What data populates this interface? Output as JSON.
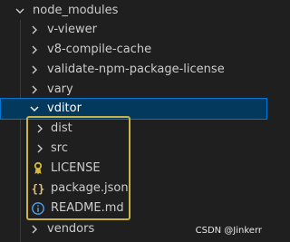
{
  "explorer": {
    "root": {
      "label": "node_modules",
      "icon": "chevron-down-icon"
    },
    "items": [
      {
        "label": "v-viewer",
        "icon": "chevron-right-icon"
      },
      {
        "label": "v8-compile-cache",
        "icon": "chevron-right-icon"
      },
      {
        "label": "validate-npm-package-license",
        "icon": "chevron-right-icon"
      },
      {
        "label": "vary",
        "icon": "chevron-right-icon"
      }
    ],
    "selected": {
      "label": "vditor",
      "icon": "chevron-down-icon"
    },
    "children": [
      {
        "label": "dist",
        "icon": "chevron-right-icon"
      },
      {
        "label": "src",
        "icon": "chevron-right-icon"
      },
      {
        "label": "LICENSE",
        "icon": "license-icon"
      },
      {
        "label": "package.json",
        "icon": "json-braces-icon"
      },
      {
        "label": "README.md",
        "icon": "info-icon"
      }
    ],
    "after": {
      "label": "vendors",
      "icon": "chevron-right-icon"
    }
  },
  "watermark": "CSDN @Jinkerr",
  "colors": {
    "background": "#1f1f1f",
    "selection_bg": "#04395e",
    "selection_border": "#0078d4",
    "highlight_box": "#c9b34a",
    "license_icon": "#d7ba3a",
    "json_icon": "#e5c07b",
    "info_icon": "#4fa3f0"
  }
}
